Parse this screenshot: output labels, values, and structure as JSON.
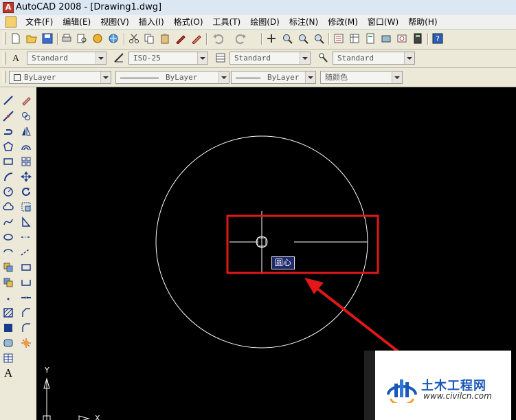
{
  "window": {
    "title": "AutoCAD 2008 - [Drawing1.dwg]",
    "app_icon_letter": "A"
  },
  "menu": [
    {
      "label": "文件(F)"
    },
    {
      "label": "编辑(E)"
    },
    {
      "label": "视图(V)"
    },
    {
      "label": "插入(I)"
    },
    {
      "label": "格式(O)"
    },
    {
      "label": "工具(T)"
    },
    {
      "label": "绘图(D)"
    },
    {
      "label": "标注(N)"
    },
    {
      "label": "修改(M)"
    },
    {
      "label": "窗口(W)"
    },
    {
      "label": "帮助(H)"
    }
  ],
  "styles_toolbar": {
    "text_style": "Standard",
    "dim_style": "ISO-25",
    "table_style": "Standard",
    "multileader_style": "Standard"
  },
  "properties_toolbar": {
    "color": "ByLayer",
    "linetype": "ByLayer",
    "lineweight": "ByLayer",
    "plot_style": "随颜色"
  },
  "canvas": {
    "tooltip": "圆心",
    "ucs_y_label": "Y",
    "ucs_x_label": "X",
    "background": "#000000",
    "geometry_color": "#ffffff",
    "annotation_color": "#e01818"
  },
  "watermark": {
    "name": "土木工程网",
    "url": "www.civilcn.com",
    "accent": "#1a58b8"
  }
}
